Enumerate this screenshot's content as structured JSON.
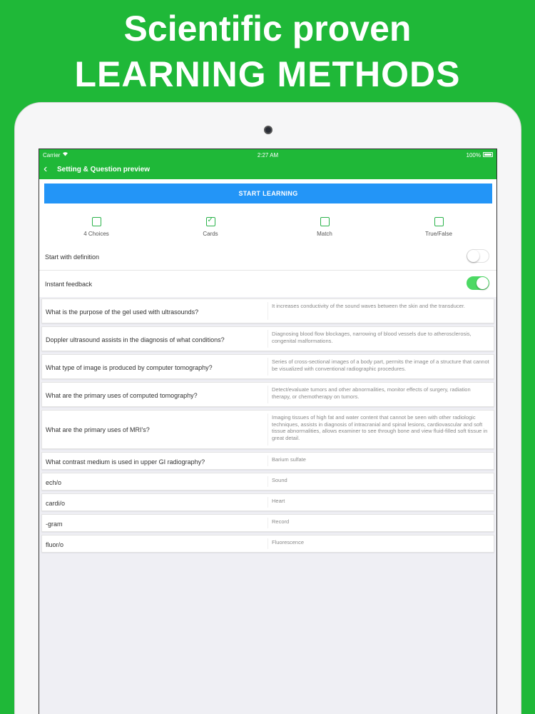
{
  "headline": {
    "line1": "Scientific proven",
    "line2": "LEARNING METHODS"
  },
  "status": {
    "carrier": "Carrier",
    "time": "2:27 AM",
    "battery": "100%"
  },
  "nav": {
    "back": "‹",
    "title": "Setting & Question preview"
  },
  "start_button": "START LEARNING",
  "modes": [
    {
      "label": "4 Choices",
      "checked": false
    },
    {
      "label": "Cards",
      "checked": true
    },
    {
      "label": "Match",
      "checked": false
    },
    {
      "label": "True/False",
      "checked": false
    }
  ],
  "settings": {
    "start_with_definition": {
      "label": "Start with definition",
      "on": false
    },
    "instant_feedback": {
      "label": "Instant feedback",
      "on": true
    }
  },
  "cards": [
    {
      "q": "What is the purpose of the gel used with ultrasounds?",
      "a": "It increases conductivity of the sound waves between the skin and the transducer."
    },
    {
      "q": "Doppler ultrasound assists in the diagnosis of what conditions?",
      "a": "Diagnosing blood flow blockages, narrowing of blood vessels due to atherosclerosis, congenital malformations."
    },
    {
      "q": "What type of image is produced by computer tomography?",
      "a": "Series of cross-sectional images of a body part, permits the image of a structure that cannot be visualized with conventional radiographic procedures."
    },
    {
      "q": "What are the primary uses of computed tomography?",
      "a": "Detect/evaluate tumors and other abnormalities, monitor effects of surgery, radiation therapy, or chemotherapy on tumors."
    },
    {
      "q": "What are the primary uses of MRI's?",
      "a": "Imaging tissues of high fat and water content that cannot be seen with other radiologic techniques, assists in diagnosis of intracranial and spinal lesions, cardiovascular and soft tissue abnormalities, allows examiner to see through bone and view fluid-filled soft tissue in great detail."
    },
    {
      "q": "What contrast medium is used in upper GI radiography?",
      "a": "Barium sulfate"
    },
    {
      "q": "ech/o",
      "a": "Sound"
    },
    {
      "q": "cardi/o",
      "a": "Heart"
    },
    {
      "q": "-gram",
      "a": "Record"
    },
    {
      "q": "fluor/o",
      "a": "Fluorescence"
    }
  ]
}
